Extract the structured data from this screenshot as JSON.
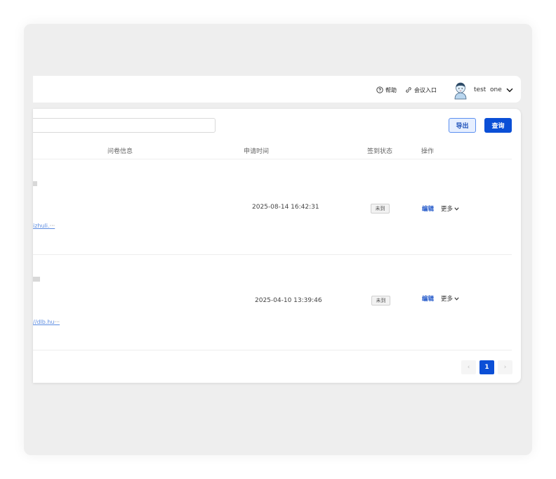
{
  "header": {
    "help_label": "帮助",
    "meeting_label": "会议入口",
    "user_name": "test  one"
  },
  "toolbar": {
    "search_value": "",
    "export_label": "导出",
    "query_label": "查询"
  },
  "table": {
    "columns": {
      "questionnaire": "问卷信息",
      "apply_time": "申请时间",
      "checkin_status": "签到状态",
      "actions": "操作"
    },
    "rows": [
      {
        "link": "izhuli.",
        "apply_time": "2025-08-14 16:42:31",
        "status": "未到",
        "edit": "编辑",
        "more": "更多"
      },
      {
        "link": "//dlb.hu",
        "apply_time": "2025-04-10 13:39:46",
        "status": "未到",
        "edit": "编辑",
        "more": "更多"
      }
    ]
  },
  "pagination": {
    "prev": "‹",
    "current": "1",
    "next": "›"
  },
  "colors": {
    "primary": "#0b4fd6",
    "link": "#5b8be0",
    "background": "#eeeeee"
  }
}
